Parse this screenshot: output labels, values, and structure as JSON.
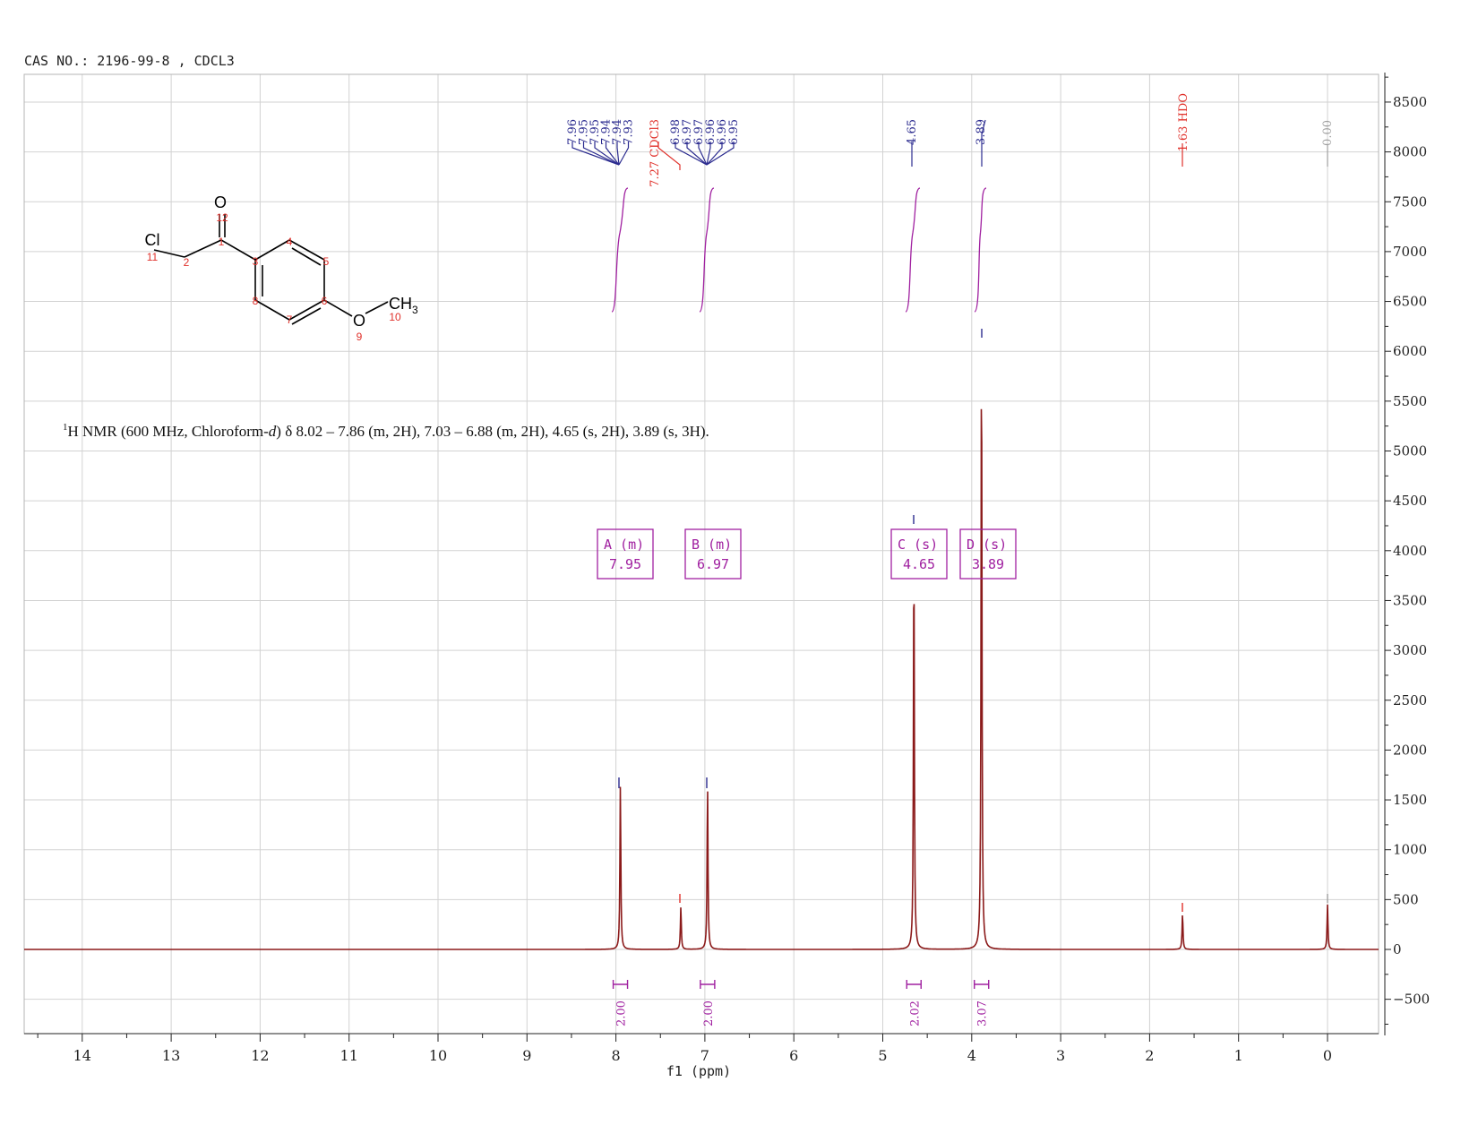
{
  "header": "CAS NO.: 2196-99-8 , CDCL3",
  "nmr_text": {
    "nucleus": "1",
    "main": "H NMR (600 MHz, Chloroform-",
    "italic": "d",
    "rest": ") δ 8.02 – 7.86 (m, 2H), 7.03 – 6.88 (m, 2H), 4.65 (s, 2H), 3.89 (s, 3H)."
  },
  "molecule": {
    "atoms": [
      "O",
      "Cl",
      "O",
      "CH",
      "3"
    ],
    "numbers": [
      "12",
      "11",
      "2",
      "1",
      "3",
      "4",
      "5",
      "6",
      "7",
      "8",
      "9",
      "10"
    ]
  },
  "colors": {
    "spectrum": "#8b1a1a",
    "peak_label": "#2b2b8f",
    "solvent_label": "#e0302a",
    "integral": "#a020a0",
    "tms_label": "#a0a0a0"
  },
  "chart_data": {
    "type": "line",
    "xlabel": "f1 (ppm)",
    "xlim": [
      14.6,
      -0.5
    ],
    "ylim": [
      -850,
      8900
    ],
    "x_ticks": [
      "14",
      "13",
      "12",
      "11",
      "10",
      "9",
      "8",
      "7",
      "6",
      "5",
      "4",
      "3",
      "2",
      "1",
      "0"
    ],
    "y_ticks": [
      "8500",
      "8000",
      "7500",
      "7000",
      "6500",
      "6000",
      "5500",
      "5000",
      "4500",
      "4000",
      "3500",
      "3000",
      "2500",
      "2000",
      "1500",
      "1000",
      "500",
      "0",
      "−500"
    ],
    "peaks": [
      {
        "ppm": 7.95,
        "height": 1650
      },
      {
        "ppm": 7.27,
        "height": 430
      },
      {
        "ppm": 6.97,
        "height": 1650
      },
      {
        "ppm": 4.65,
        "height": 4050
      },
      {
        "ppm": 3.89,
        "height": 6180
      },
      {
        "ppm": 1.63,
        "height": 360
      },
      {
        "ppm": 0.0,
        "height": 450
      }
    ],
    "peak_labels": {
      "group_a": [
        "7.96",
        "7.95",
        "7.95",
        "7.94",
        "7.94",
        "7.93"
      ],
      "solvent": "7.27 CDCl3",
      "group_b": [
        "6.98",
        "6.97",
        "6.97",
        "6.96",
        "6.96",
        "6.95"
      ],
      "singlet_c": "4.65",
      "singlet_d": "3.89",
      "hdo": "1.63 HDO",
      "tms": "0.00"
    },
    "multiplets": [
      {
        "id": "A",
        "mult": "(m)",
        "shift": "7.95"
      },
      {
        "id": "B",
        "mult": "(m)",
        "shift": "6.97"
      },
      {
        "id": "C",
        "mult": "(s)",
        "shift": "4.65"
      },
      {
        "id": "D",
        "mult": "(s)",
        "shift": "3.89"
      }
    ],
    "integrals": [
      {
        "ppm": 7.95,
        "value": "2.00"
      },
      {
        "ppm": 6.97,
        "value": "2.00"
      },
      {
        "ppm": 4.65,
        "value": "2.02"
      },
      {
        "ppm": 3.89,
        "value": "3.07"
      }
    ]
  }
}
